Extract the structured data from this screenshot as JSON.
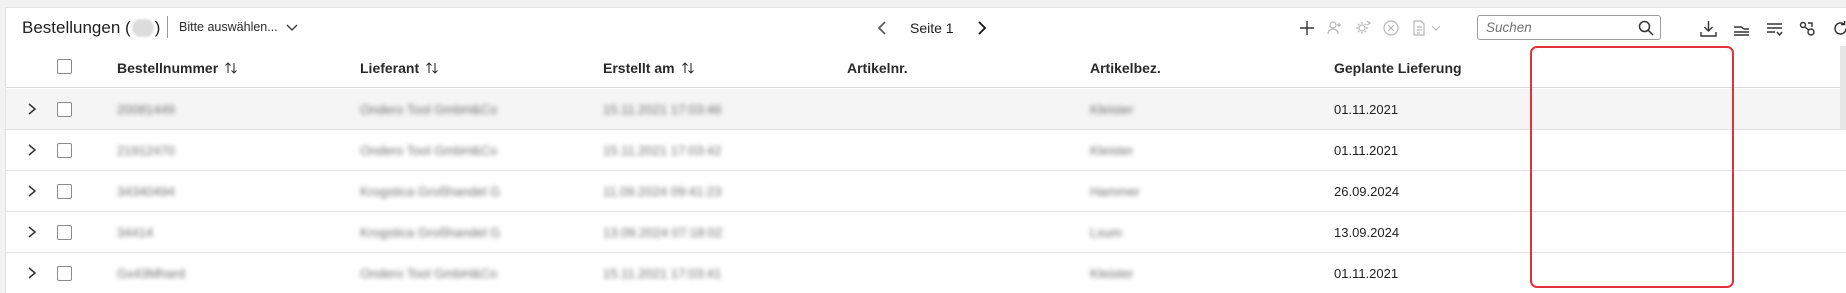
{
  "header": {
    "title_prefix": "Bestellungen (",
    "title_suffix": ")",
    "selector_label": "Bitte auswählen..."
  },
  "pager": {
    "label": "Seite 1"
  },
  "search": {
    "placeholder": "Suchen"
  },
  "columns": {
    "order_number": "Bestellnummer",
    "supplier": "Lieferant",
    "created": "Erstellt am",
    "article_no": "Artikelnr.",
    "article_desc": "Artikelbez.",
    "planned_delivery": "Geplante Lieferung"
  },
  "rows": [
    {
      "order_number": "20081449",
      "supplier": "Ondero Tool GmbH&Co",
      "created": "15.11.2021 17:03:46",
      "article_no": "",
      "article_desc": "Kleister",
      "planned_delivery": "01.11.2021"
    },
    {
      "order_number": "21912470",
      "supplier": "Ondero Tool GmbH&Co",
      "created": "15.11.2021 17:03:42",
      "article_no": "",
      "article_desc": "Kleister",
      "planned_delivery": "01.11.2021"
    },
    {
      "order_number": "34340494",
      "supplier": "Krogstica Großhandel G",
      "created": "11.09.2024 09:41:23",
      "article_no": "",
      "article_desc": "Hammer",
      "planned_delivery": "26.09.2024"
    },
    {
      "order_number": "34414",
      "supplier": "Krogstica Großhandel G",
      "created": "13.09.2024 07:18:02",
      "article_no": "",
      "article_desc": "Lsum",
      "planned_delivery": "13.09.2024"
    },
    {
      "order_number": "Gx43Mhard",
      "supplier": "Ondero Tool GmbH&Co",
      "created": "15.11.2021 17:03:41",
      "article_no": "",
      "article_desc": "Kleister",
      "planned_delivery": "01.11.2021"
    }
  ],
  "colors": {
    "highlight": "#e0323a",
    "row_hover": "#f5f5f5",
    "border": "#d9d9d9"
  }
}
